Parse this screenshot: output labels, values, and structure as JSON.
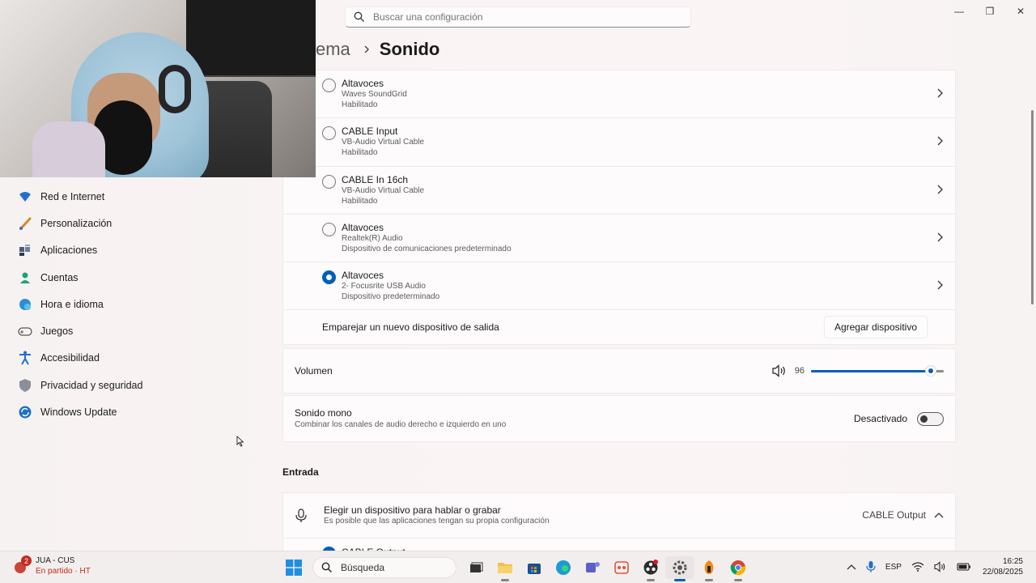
{
  "window": {
    "search_placeholder": "Buscar una configuración",
    "controls": {
      "minimize": "—",
      "restore": "❐",
      "close": "✕"
    }
  },
  "breadcrumb": {
    "parent": "ema",
    "current": "Sonido"
  },
  "sidebar": {
    "items": [
      {
        "label": "Red e Internet",
        "icon": "wifi-icon"
      },
      {
        "label": "Personalización",
        "icon": "brush-icon"
      },
      {
        "label": "Aplicaciones",
        "icon": "apps-icon"
      },
      {
        "label": "Cuentas",
        "icon": "person-icon"
      },
      {
        "label": "Hora e idioma",
        "icon": "globe-clock-icon"
      },
      {
        "label": "Juegos",
        "icon": "gamepad-icon"
      },
      {
        "label": "Accesibilidad",
        "icon": "accessibility-icon"
      },
      {
        "label": "Privacidad y seguridad",
        "icon": "shield-icon"
      },
      {
        "label": "Windows Update",
        "icon": "update-icon"
      }
    ]
  },
  "output_devices": [
    {
      "name": "Altavoces",
      "driver": "Waves SoundGrid",
      "status": "Habilitado",
      "selected": false
    },
    {
      "name": "CABLE Input",
      "driver": "VB-Audio Virtual Cable",
      "status": "Habilitado",
      "selected": false
    },
    {
      "name": "CABLE In 16ch",
      "driver": "VB-Audio Virtual Cable",
      "status": "Habilitado",
      "selected": false
    },
    {
      "name": "Altavoces",
      "driver": "Realtek(R) Audio",
      "status": "Dispositivo de comunicaciones predeterminado",
      "selected": false
    },
    {
      "name": "Altavoces",
      "driver": "2- Focusrite USB Audio",
      "status": "Dispositivo predeterminado",
      "selected": true
    }
  ],
  "pair": {
    "label": "Emparejar un nuevo dispositivo de salida",
    "button": "Agregar dispositivo"
  },
  "volume": {
    "label": "Volumen",
    "value": "96",
    "level": 0.96
  },
  "mono": {
    "title": "Sonido mono",
    "subtitle": "Combinar los canales de audio derecho e izquierdo en uno",
    "state_label": "Desactivado",
    "on": false
  },
  "input": {
    "section_title": "Entrada",
    "choose_title": "Elegir un dispositivo para hablar o grabar",
    "choose_subtitle": "Es posible que las aplicaciones tengan su propia configuración",
    "current_device": "CABLE Output",
    "devices": [
      {
        "name": "CABLE Output",
        "selected": true
      }
    ]
  },
  "taskbar": {
    "news": {
      "badge": "2",
      "line1": "JUA - CUS",
      "line2": "En partido · HT"
    },
    "search_label": "Búsqueda",
    "apps": [
      "task-view",
      "file-explorer",
      "store",
      "edge",
      "teams",
      "snipping-tool",
      "obs",
      "settings",
      "fl-studio",
      "chrome"
    ],
    "tray": {
      "language": "ESP",
      "time": "16:25",
      "date": "22/08/2025"
    }
  },
  "colors": {
    "accent": "#005fb8",
    "background": "#f9f3f3",
    "card": "#fdfbfb"
  }
}
